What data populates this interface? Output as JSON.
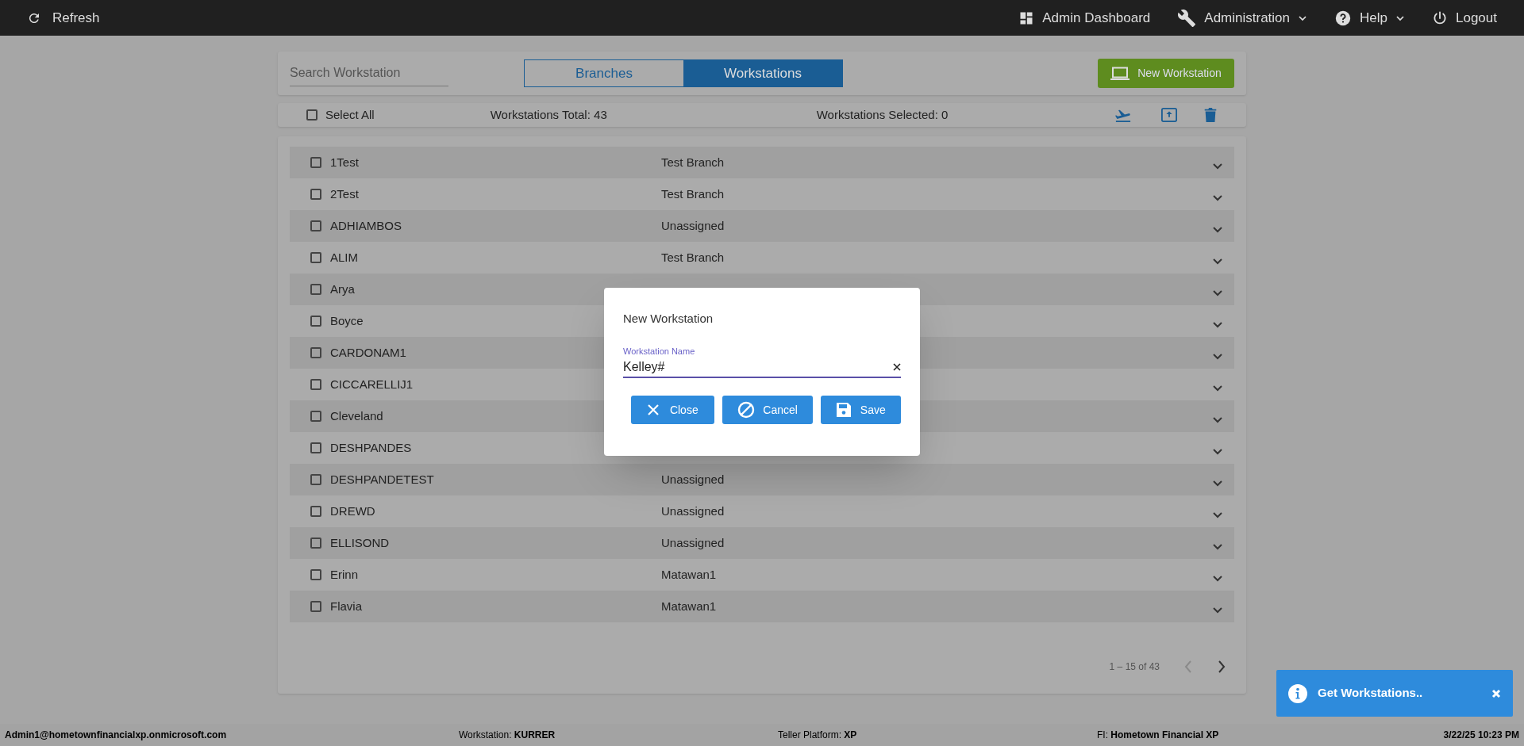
{
  "top_bar": {
    "refresh": "Refresh",
    "nav": [
      {
        "kind": "dashboard",
        "label": "Admin Dashboard",
        "caret": false
      },
      {
        "kind": "wrench",
        "label": "Administration",
        "caret": true
      },
      {
        "kind": "help",
        "label": "Help",
        "caret": true
      },
      {
        "kind": "power",
        "label": "Logout",
        "caret": false
      }
    ]
  },
  "search": {
    "placeholder": "Search Workstation"
  },
  "tabs": [
    {
      "label": "Branches",
      "selected": false
    },
    {
      "label": "Workstations",
      "selected": true
    }
  ],
  "new_button": "New Workstation",
  "toolbar": {
    "select_all": {
      "label": "Select All",
      "checked": false
    },
    "total": "Workstations Total: 43",
    "selected_count": "Workstations Selected: 0"
  },
  "rows": [
    {
      "name": "1Test",
      "branch": "Test Branch",
      "checked": false
    },
    {
      "name": "2Test",
      "branch": "Test Branch",
      "checked": false
    },
    {
      "name": "ADHIAMBOS",
      "branch": "Unassigned",
      "checked": false
    },
    {
      "name": "ALIM",
      "branch": "Test Branch",
      "checked": false
    },
    {
      "name": "Arya",
      "checked": false
    },
    {
      "name": "Boyce",
      "checked": false
    },
    {
      "name": "CARDONAM1",
      "checked": false
    },
    {
      "name": "CICCARELLIJ1",
      "checked": false
    },
    {
      "name": "Cleveland",
      "checked": false
    },
    {
      "name": "DESHPANDES",
      "checked": false
    },
    {
      "name": "DESHPANDETEST",
      "branch": "Unassigned",
      "checked": false
    },
    {
      "name": "DREWD",
      "branch": "Unassigned",
      "checked": false
    },
    {
      "name": "ELLISOND",
      "branch": "Unassigned",
      "checked": false
    },
    {
      "name": "Erinn",
      "branch": "Matawan1",
      "checked": false
    },
    {
      "name": "Flavia",
      "branch": "Matawan1",
      "checked": false
    }
  ],
  "pagination": {
    "range": "1 – 15 of 43",
    "prev_disabled": true,
    "next_disabled": false
  },
  "dialog": {
    "title": "New Workstation",
    "field_label": "Workstation Name",
    "value": "Kelley#",
    "buttons": [
      {
        "kind": "close",
        "label": "Close"
      },
      {
        "kind": "cancel",
        "label": "Cancel"
      },
      {
        "kind": "save",
        "label": "Save"
      }
    ]
  },
  "toast": {
    "text": "Get Workstations.."
  },
  "status_bar": [
    {
      "value": "Admin1@hometownfinancialxp.onmicrosoft.com"
    },
    {
      "label": "Workstation:",
      "value": "KURRER"
    },
    {
      "label": "Teller Platform:",
      "value": "XP"
    },
    {
      "label": "FI:",
      "value": "Hometown Financial XP"
    },
    {
      "value": "3/22/25 10:23 PM"
    }
  ]
}
